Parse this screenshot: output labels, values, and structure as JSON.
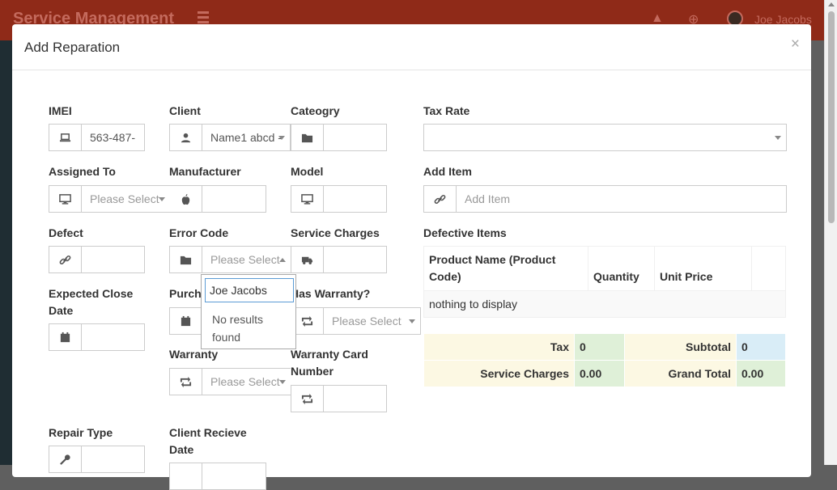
{
  "app": {
    "brand": "Service Management",
    "user_name": "Joe Jacobs",
    "icons": [
      "bars-icon",
      "warning-icon",
      "plus-circle-icon",
      "avatar"
    ]
  },
  "modal": {
    "title": "Add Reparation",
    "close": "×"
  },
  "form": {
    "imei": {
      "label": "IMEI",
      "value": "563-487-",
      "icon": "laptop-icon"
    },
    "client": {
      "label": "Client",
      "value": "Name1 abcd -",
      "icon": "user-icon"
    },
    "category": {
      "label": "Cateogry",
      "value": "",
      "icon": "folder-icon"
    },
    "tax_rate": {
      "label": "Tax Rate",
      "value": ""
    },
    "assigned_to": {
      "label": "Assigned To",
      "placeholder": "Please Select",
      "icon": "desktop-icon"
    },
    "manufacturer": {
      "label": "Manufacturer",
      "value": "",
      "icon": "apple-icon"
    },
    "model": {
      "label": "Model",
      "value": "",
      "icon": "desktop-icon"
    },
    "add_item": {
      "label": "Add Item",
      "placeholder": "Add Item",
      "icon": "link-icon"
    },
    "defect": {
      "label": "Defect",
      "value": "",
      "icon": "link-icon"
    },
    "error_code": {
      "label": "Error Code",
      "placeholder": "Please Select",
      "icon": "folder-icon"
    },
    "service_charges": {
      "label": "Service Charges",
      "value": "",
      "icon": "truck-icon"
    },
    "expected_close_date": {
      "label": "Expected Close Date",
      "value": "",
      "icon": "calendar-icon"
    },
    "purchase": {
      "label": "Purch",
      "value": "",
      "icon": "calendar-icon"
    },
    "has_warranty": {
      "label": "Has Warranty?",
      "placeholder": "Please Select",
      "icon": "retweet-icon"
    },
    "warranty": {
      "label": "Warranty",
      "placeholder": "Please Select",
      "icon": "retweet-icon"
    },
    "warranty_card_number": {
      "label": "Warranty Card Number",
      "value": "",
      "icon": "retweet-icon"
    },
    "repair_type": {
      "label": "Repair Type",
      "value": "",
      "icon": "wrench-icon"
    },
    "client_receive_date": {
      "label": "Client Recieve Date"
    }
  },
  "dropdown": {
    "search_value": "Joe Jacobs",
    "message": "No results found"
  },
  "defective_items": {
    "title": "Defective Items",
    "columns": [
      "Product Name (Product Code)",
      "Quantity",
      "Unit Price",
      ""
    ],
    "empty": "nothing to display"
  },
  "totals": {
    "tax_label": "Tax",
    "tax_value": "0",
    "subtotal_label": "Subtotal",
    "subtotal_value": "0",
    "service_charges_label": "Service Charges",
    "service_charges_value": "0.00",
    "grand_total_label": "Grand Total",
    "grand_total_value": "0.00"
  },
  "colors": {
    "topbar": "#8f2a18",
    "overlay": "#5f5f5f",
    "dropdown_focus": "#5b9bd5",
    "totals_label_bg": "#fcf8e3",
    "totals_green_bg": "#dff0d8",
    "totals_blue_bg": "#d9edf7"
  }
}
